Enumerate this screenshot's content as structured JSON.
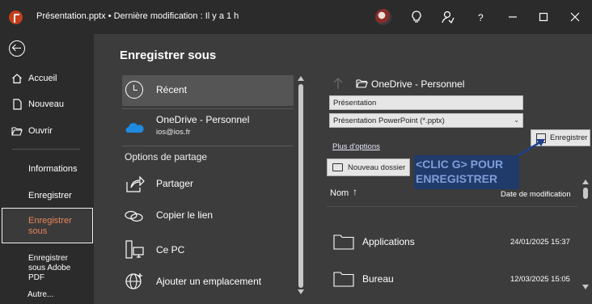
{
  "titlebar": {
    "document": "Présentation.pptx",
    "separator": "•",
    "modified": "Dernière modification : Il y a 1 h"
  },
  "sidebar": {
    "items": [
      {
        "label": "Accueil",
        "icon": "home-icon"
      },
      {
        "label": "Nouveau",
        "icon": "new-document-icon"
      },
      {
        "label": "Ouvrir",
        "icon": "open-folder-icon"
      },
      {
        "label": "Informations"
      },
      {
        "label": "Enregistrer"
      },
      {
        "label": "Enregistrer sous",
        "selected": true
      },
      {
        "label": "Enregistrer sous Adobe PDF"
      },
      {
        "label": "Autre..."
      }
    ]
  },
  "main": {
    "title": "Enregistrer sous",
    "locations": {
      "recent": "Récent",
      "onedrive": "OneDrive - Personnel",
      "onedrive_account": "ios@ios.fr",
      "sharing_header": "Options de partage",
      "share": "Partager",
      "copy_link": "Copier le lien",
      "this_pc": "Ce PC",
      "add_location": "Ajouter un emplacement"
    }
  },
  "save_panel": {
    "path": "OneDrive - Personnel",
    "filename": "Présentation",
    "format": "Présentation PowerPoint (*.pptx)",
    "save_button": "Enregistrer",
    "more_options": "Plus d'options",
    "new_folder": "Nouveau dossier",
    "column_name": "Nom",
    "sort_arrow": "↑",
    "column_date": "Date de modification",
    "files": [
      {
        "name": "Applications",
        "date": "24/01/2025 15:37"
      },
      {
        "name": "Bureau",
        "date": "12/03/2025 15:05"
      }
    ]
  },
  "annotation": {
    "line1": "<CLIC G> POUR",
    "line2": "ENREGISTRER"
  },
  "colors": {
    "accent_selected": "#e8855a",
    "annotation_bg": "#203a6a",
    "annotation_text": "#7f9ed8"
  }
}
